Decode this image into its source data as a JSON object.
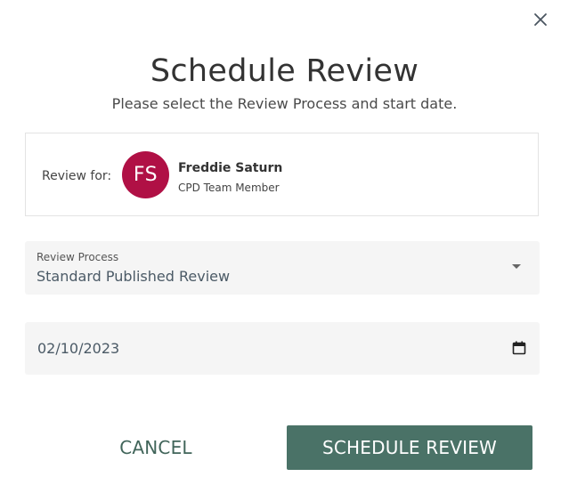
{
  "dialog": {
    "title": "Schedule Review",
    "subtitle": "Please select the Review Process and start date.",
    "close_icon": "close-icon"
  },
  "review_for": {
    "label": "Review for:",
    "avatar_initials": "FS",
    "avatar_color": "#b01045",
    "name": "Freddie Saturn",
    "role": "CPD Team Member"
  },
  "review_process": {
    "label": "Review Process",
    "value": "Standard Published Review",
    "icon": "chevron-down-icon"
  },
  "start_date": {
    "value": "02/10/2023",
    "icon": "calendar-icon"
  },
  "actions": {
    "cancel_label": "CANCEL",
    "submit_label": "SCHEDULE REVIEW",
    "accent_color": "#4a7267"
  }
}
